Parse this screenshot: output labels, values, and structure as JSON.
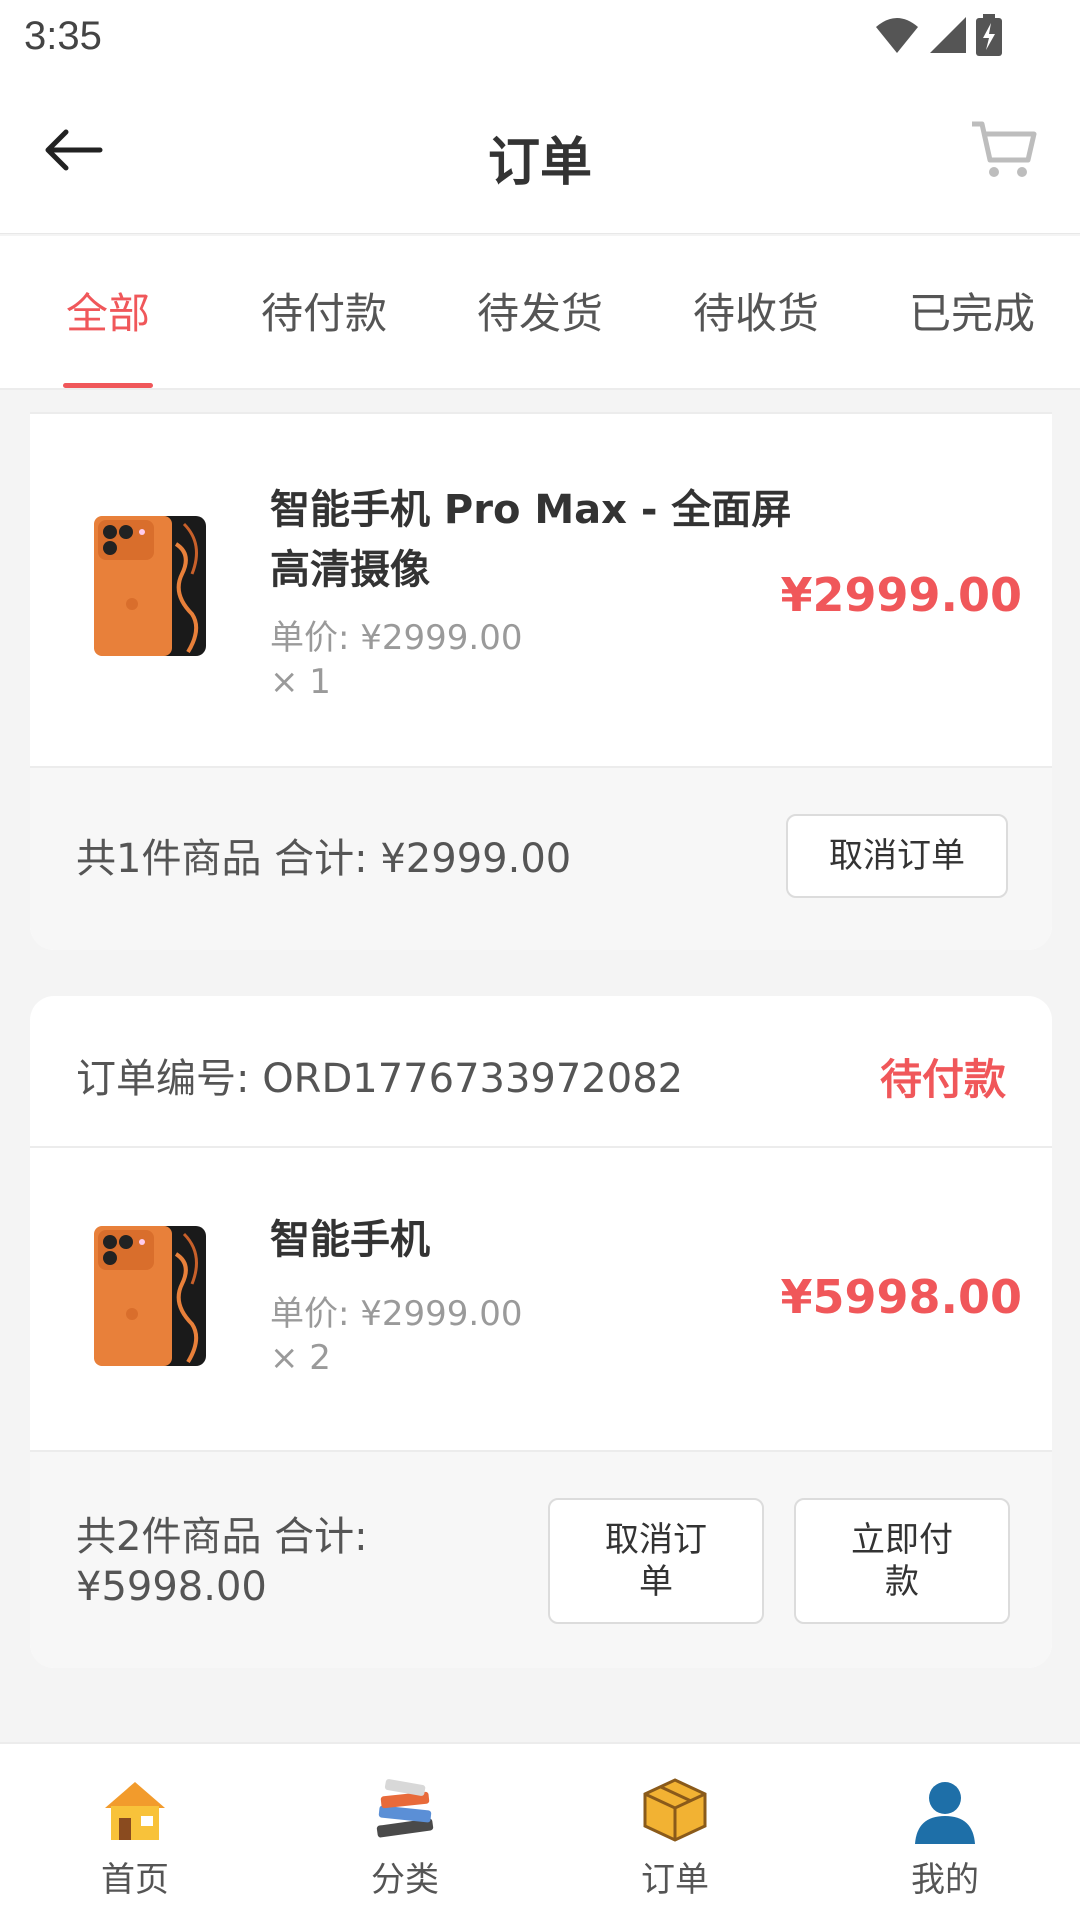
{
  "status_bar": {
    "time": "3:35"
  },
  "nav": {
    "title": "订单"
  },
  "tabs": [
    {
      "label": "全部",
      "active": true
    },
    {
      "label": "待付款",
      "active": false
    },
    {
      "label": "待发货",
      "active": false
    },
    {
      "label": "待收货",
      "active": false
    },
    {
      "label": "已完成",
      "active": false
    }
  ],
  "orders": [
    {
      "item": {
        "name": "智能手机 Pro Max - 全面屏高清摄像",
        "unit_price": "单价: ¥2999.00",
        "qty": "× 1",
        "total": "¥2999.00"
      },
      "summary": "共1件商品 合计: ¥2999.00",
      "buttons": [
        "取消订单"
      ]
    },
    {
      "order_no": "订单编号: ORD1776733972082",
      "status": "待付款",
      "item": {
        "name": "智能手机",
        "unit_price": "单价: ¥2999.00",
        "qty": "× 2",
        "total": "¥5998.00"
      },
      "summary": "共2件商品 合计: ¥5998.00",
      "buttons": [
        "取消订单",
        "立即付款"
      ]
    }
  ],
  "bottom_nav": [
    {
      "label": "首页",
      "icon": "home-icon"
    },
    {
      "label": "分类",
      "icon": "books-icon"
    },
    {
      "label": "订单",
      "icon": "box-icon"
    },
    {
      "label": "我的",
      "icon": "user-icon"
    }
  ],
  "colors": {
    "accent": "#f0575a",
    "phone_orange": "#e8803a"
  }
}
